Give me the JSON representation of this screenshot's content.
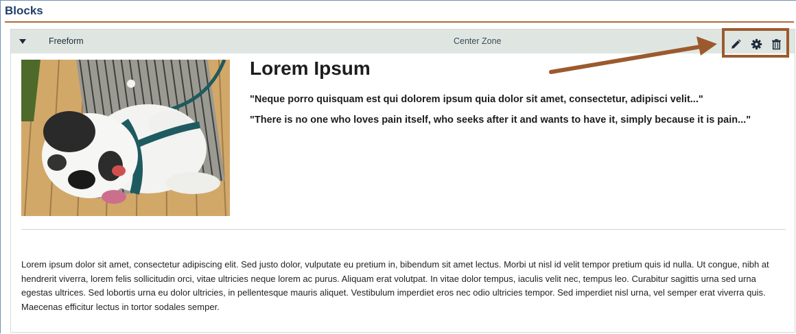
{
  "page": {
    "heading": "Blocks"
  },
  "block": {
    "name": "Freeform",
    "zone": "Center Zone",
    "actions": [
      {
        "icon": "pencil-icon",
        "label": "Edit"
      },
      {
        "icon": "gear-icon",
        "label": "Settings"
      },
      {
        "icon": "trash-icon",
        "label": "Delete"
      }
    ]
  },
  "content": {
    "title": "Lorem Ipsum",
    "quote1": "\"Neque porro quisquam est qui dolorem ipsum quia dolor sit amet, consectetur, adipisci velit...\"",
    "quote2": "\"There is no one who loves pain itself, who seeks after it and wants to have it, simply because it is pain...\"",
    "paragraph": "Lorem ipsum dolor sit amet, consectetur adipiscing elit. Sed justo dolor, vulputate eu pretium in, bibendum sit amet lectus. Morbi ut nisl id velit tempor pretium quis id nulla. Ut congue, nibh at hendrerit viverra, lorem felis sollicitudin orci, vitae ultricies neque lorem ac purus. Aliquam erat volutpat. In vitae dolor tempus, iaculis velit nec, tempus leo. Curabitur sagittis urna sed urna egestas ultrices. Sed lobortis urna eu dolor ultricies, in pellentesque mauris aliquet. Vestibulum imperdiet eros nec odio ultricies tempor. Sed imperdiet nisl urna, vel semper erat viverra quis. Maecenas efficitur lectus in tortor sodales semper."
  },
  "colors": {
    "heading": "#1f3f6a",
    "rule": "#b06a3a",
    "header_bg": "#dfe6e2",
    "annotation": "#9b5a2e"
  }
}
